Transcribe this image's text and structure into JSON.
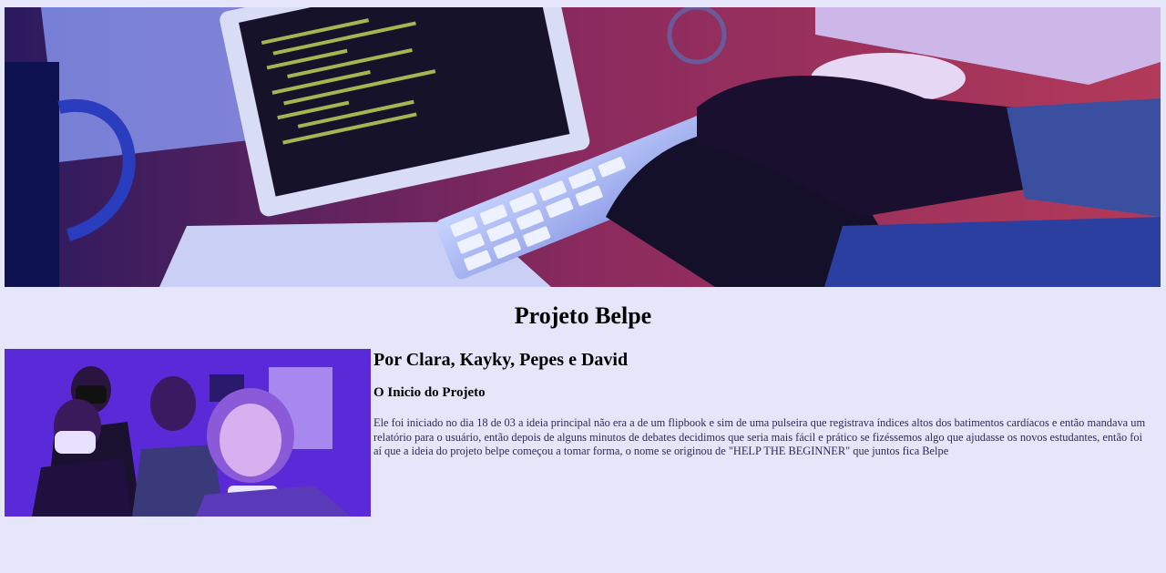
{
  "header": {
    "banner_image": "laptop-keyboard-coding-photo"
  },
  "title": "Projeto Belpe",
  "group_photo": "team-selfie-photo",
  "authors": "Por Clara, Kayky, Pepes e David",
  "section": {
    "title": "O Inicio do Projeto",
    "text": "Ele foi iniciado no dia 18 de 03 a ideia principal não era a de um flipbook e sim de uma pulseira que registrava índices altos dos batimentos cardíacos e então mandava um relatório para o usuário, então depois de alguns minutos de debates decidimos que seria mais fácil e prático se fizéssemos algo que ajudasse os novos estudantes, então foi aí que a ideia do projeto belpe começou a tomar forma, o nome se originou de \"HELP THE BEGINNER\" que juntos fica Belpe"
  },
  "colors": {
    "background": "#e6e6fa",
    "text": "#2a2a5a"
  }
}
